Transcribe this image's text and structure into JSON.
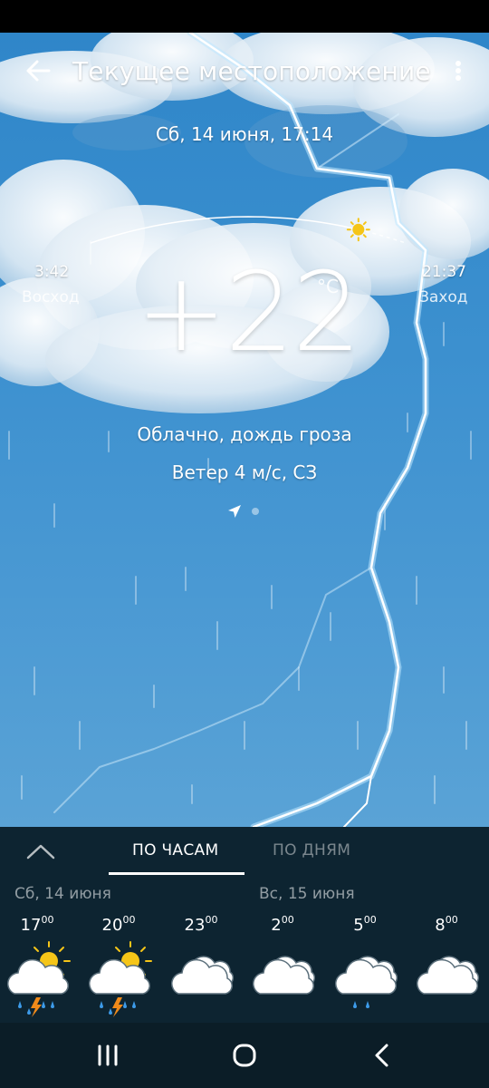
{
  "header": {
    "title": "Текущее местоположение"
  },
  "current": {
    "date": "Сб, 14 июня, 17:14",
    "temperature": "+22",
    "unit": "°C",
    "condition": "Облачно, дождь гроза",
    "wind": "Ветер 4 м/с, СЗ"
  },
  "sun": {
    "sunrise_time": "3:42",
    "sunrise_label": "Восход",
    "sunset_time": "21:37",
    "sunset_label": "Заход",
    "day_progress": 0.85
  },
  "forecast": {
    "tabs": [
      {
        "label": "ПО ЧАСАМ",
        "active": true
      },
      {
        "label": "ПО ДНЯМ",
        "active": false
      }
    ],
    "days": [
      "Сб, 14 июня",
      "Вс, 15 июня"
    ],
    "hours": [
      {
        "hour": "17",
        "min": "00",
        "icon": "cloud-sun-thunder-rain-icon"
      },
      {
        "hour": "20",
        "min": "00",
        "icon": "cloud-sun-thunder-rain-icon"
      },
      {
        "hour": "23",
        "min": "00",
        "icon": "cloudy-icon"
      },
      {
        "hour": "2",
        "min": "00",
        "icon": "cloudy-icon"
      },
      {
        "hour": "5",
        "min": "00",
        "icon": "cloud-rain-icon"
      },
      {
        "hour": "8",
        "min": "00",
        "icon": "cloudy-icon"
      }
    ]
  },
  "colors": {
    "sky": "#3c90cf",
    "panel": "#0d2431",
    "sun": "#f5c518",
    "bolt": "#f08a1a",
    "drop": "#3d9be9"
  }
}
